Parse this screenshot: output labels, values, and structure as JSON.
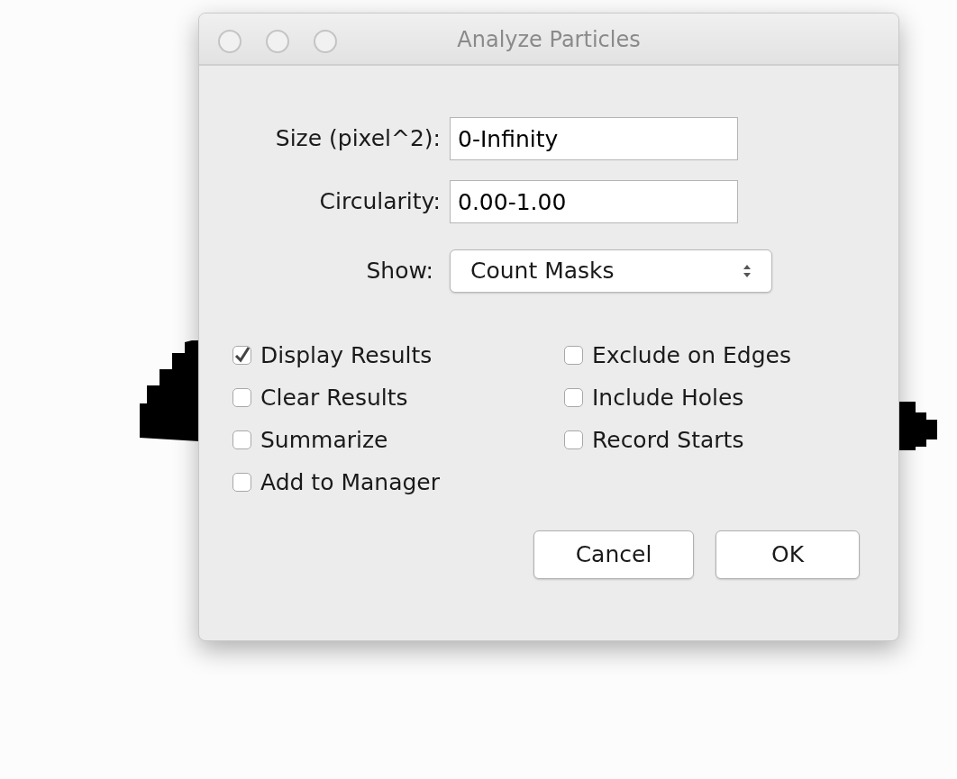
{
  "window": {
    "title": "Analyze Particles"
  },
  "fields": [
    {
      "label": "Size (pixel^2):",
      "value": "0-Infinity"
    },
    {
      "label": "Circularity:",
      "value": "0.00-1.00"
    }
  ],
  "show": {
    "label": "Show:",
    "value": "Count Masks"
  },
  "checkbox_columns": [
    [
      {
        "label": "Display Results",
        "checked": true
      },
      {
        "label": "Clear Results",
        "checked": false
      },
      {
        "label": "Summarize",
        "checked": false
      },
      {
        "label": "Add to Manager",
        "checked": false
      }
    ],
    [
      {
        "label": "Exclude on Edges",
        "checked": false
      },
      {
        "label": "Include Holes",
        "checked": false
      },
      {
        "label": "Record Starts",
        "checked": false
      }
    ]
  ],
  "buttons": [
    {
      "label": "Cancel",
      "kind": "cancel"
    },
    {
      "label": "OK",
      "kind": "ok"
    }
  ]
}
